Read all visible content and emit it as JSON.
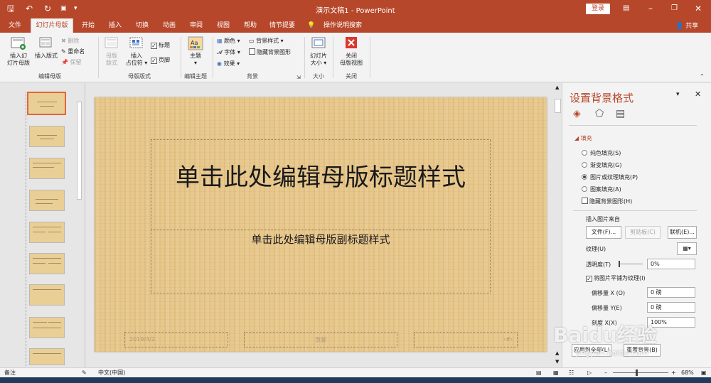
{
  "titlebar": {
    "doc_title": "演示文稿1",
    "app": "PowerPoint",
    "title_sep": " - ",
    "login": "登录",
    "share": "共享"
  },
  "tabs": [
    "文件",
    "幻灯片母版",
    "开始",
    "插入",
    "切换",
    "动画",
    "审阅",
    "视图",
    "帮助",
    "情节提要",
    "操作说明搜索"
  ],
  "active_tab": "幻灯片母版",
  "ribbon": {
    "insert_slide_master": "插入幻灯片母版",
    "insert_slide_master_l1": "插入幻",
    "insert_slide_master_l2": "灯片母版",
    "insert_layout": "插入版式",
    "delete": "删除",
    "rename": "重命名",
    "preserve": "保留",
    "group_edit_master": "编辑母版",
    "master_layout_l1": "母版",
    "master_layout_l2": "版式",
    "insert_placeholder_l1": "插入",
    "insert_placeholder_l2": "占位符",
    "title_cb": "标题",
    "footer_cb": "页脚",
    "group_master_layout": "母版版式",
    "themes": "主题",
    "group_edit_theme": "编辑主题",
    "colors": "颜色",
    "fonts": "字体",
    "effects": "效果",
    "bg_styles": "背景样式",
    "hide_bg": "隐藏背景图形",
    "group_background": "背景",
    "slide_size_l1": "幻灯片",
    "slide_size_l2": "大小",
    "group_size": "大小",
    "close_master_l1": "关闭",
    "close_master_l2": "母版视图",
    "group_close": "关闭"
  },
  "slide": {
    "title": "单击此处编辑母版标题样式",
    "subtitle": "单击此处编辑母版副标题样式",
    "date": "2019/4/2",
    "footer": "页脚",
    "number": "‹#›"
  },
  "format_pane": {
    "title": "设置背景格式",
    "section_fill": "填充",
    "opt_solid": "纯色填充(S)",
    "opt_gradient": "渐变填充(G)",
    "opt_picture": "图片或纹理填充(P)",
    "opt_pattern": "图案填充(A)",
    "hide_bg_graphics": "隐藏背景图形(H)",
    "insert_from": "插入图片来自",
    "btn_file": "文件(F)...",
    "btn_clipboard": "剪贴板(C)",
    "btn_online": "联机(E)...",
    "texture": "纹理(U)",
    "transparency": "透明度(T)",
    "transparency_val": "0%",
    "tile": "将图片平铺为纹理(I)",
    "offset_x": "偏移量 X (O)",
    "offset_x_val": "0 磅",
    "offset_y": "偏移量 Y(E)",
    "offset_y_val": "0 磅",
    "scale_x": "刻度 X(X)",
    "scale_x_val": "100%",
    "apply_all": "应用到全部(L)",
    "reset_bg": "重置背景(B)"
  },
  "status": {
    "notes": "备注",
    "language": "中文(中国)",
    "zoom": "68%"
  },
  "watermark": {
    "brand": "Baidu经验",
    "url": "jingyan.baidu.com"
  },
  "colors": {
    "accent": "#b7472a",
    "slide_bg": "#e8c88c"
  }
}
